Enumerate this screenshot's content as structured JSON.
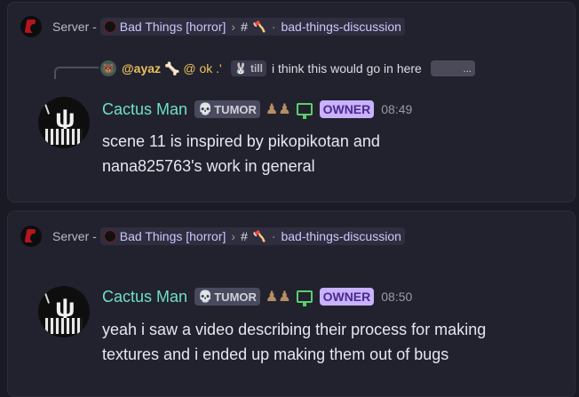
{
  "messages": [
    {
      "breadcrumb": {
        "prefix": "Server -",
        "server_name": "Bad Things [horror]",
        "channel_name": "bad-things-discussion"
      },
      "reply": {
        "avatar_glyph": "🐻",
        "username": "@ayaz",
        "badge": "🦴 @ ok .'",
        "tag": "🐰 till",
        "text": "i think this would go in here",
        "attachment_label": "..."
      },
      "author": {
        "name": "Cactus Man",
        "tag_icon": "💀",
        "tag_label": "TUMOR",
        "role_badge": "OWNER",
        "time": "08:49"
      },
      "content_lines": [
        "scene 11 is inspired by pikopikotan and",
        "nana825763's work in general"
      ]
    },
    {
      "breadcrumb": {
        "prefix": "Server -",
        "server_name": "Bad Things [horror]",
        "channel_name": "bad-things-discussion"
      },
      "author": {
        "name": "Cactus Man",
        "tag_icon": "💀",
        "tag_label": "TUMOR",
        "role_badge": "OWNER",
        "time": "08:50"
      },
      "content_lines": [
        "yeah i saw a video describing their process for making",
        "textures and i ended up making them out of bugs"
      ]
    }
  ],
  "colors": {
    "background": "#1a1a24",
    "card": "#22222f",
    "username": "#6ee0c6",
    "owner_badge": "#c9b2ff",
    "reply_name": "#e7c15a"
  },
  "icons": {
    "server": "server-icon",
    "monitor": "monitor-icon",
    "skull": "skull-icon",
    "axe": "axe-icon"
  }
}
